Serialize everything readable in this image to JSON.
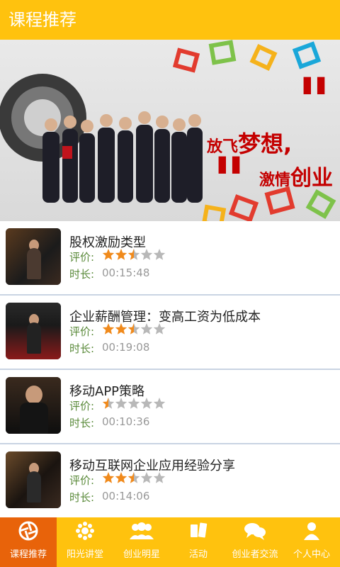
{
  "header": {
    "title": "课程推荐"
  },
  "banner": {
    "slogan_line1_a": "放飞",
    "slogan_line1_b": "梦想,",
    "slogan_line2_a": "激情",
    "slogan_line2_b": "创业"
  },
  "courses": [
    {
      "title": "股权激励类型",
      "rating_label": "评价:",
      "rating": 2.5,
      "duration_label": "时长:",
      "duration": "00:15:48"
    },
    {
      "title": "企业薪酬管理：变高工资为低成本",
      "rating_label": "评价:",
      "rating": 2.5,
      "duration_label": "时长:",
      "duration": "00:19:08"
    },
    {
      "title": "移动APP策略",
      "rating_label": "评价:",
      "rating": 0.5,
      "duration_label": "时长:",
      "duration": "00:10:36"
    },
    {
      "title": "移动互联网企业应用经验分享",
      "rating_label": "评价:",
      "rating": 2.5,
      "duration_label": "时长:",
      "duration": "00:14:06"
    }
  ],
  "tabs": [
    {
      "label": "课程推荐",
      "icon": "aperture-icon",
      "active": true
    },
    {
      "label": "阳光讲堂",
      "icon": "sun-icon",
      "active": false
    },
    {
      "label": "创业明星",
      "icon": "people-icon",
      "active": false
    },
    {
      "label": "活动",
      "icon": "puzzle-icon",
      "active": false
    },
    {
      "label": "创业者交流",
      "icon": "chat-icon",
      "active": false
    },
    {
      "label": "个人中心",
      "icon": "person-icon",
      "active": false
    }
  ],
  "colors": {
    "primary": "#ffc20e",
    "active_tab": "#e8630a",
    "star_on": "#f08a1c",
    "star_off": "#b8b8b8"
  }
}
